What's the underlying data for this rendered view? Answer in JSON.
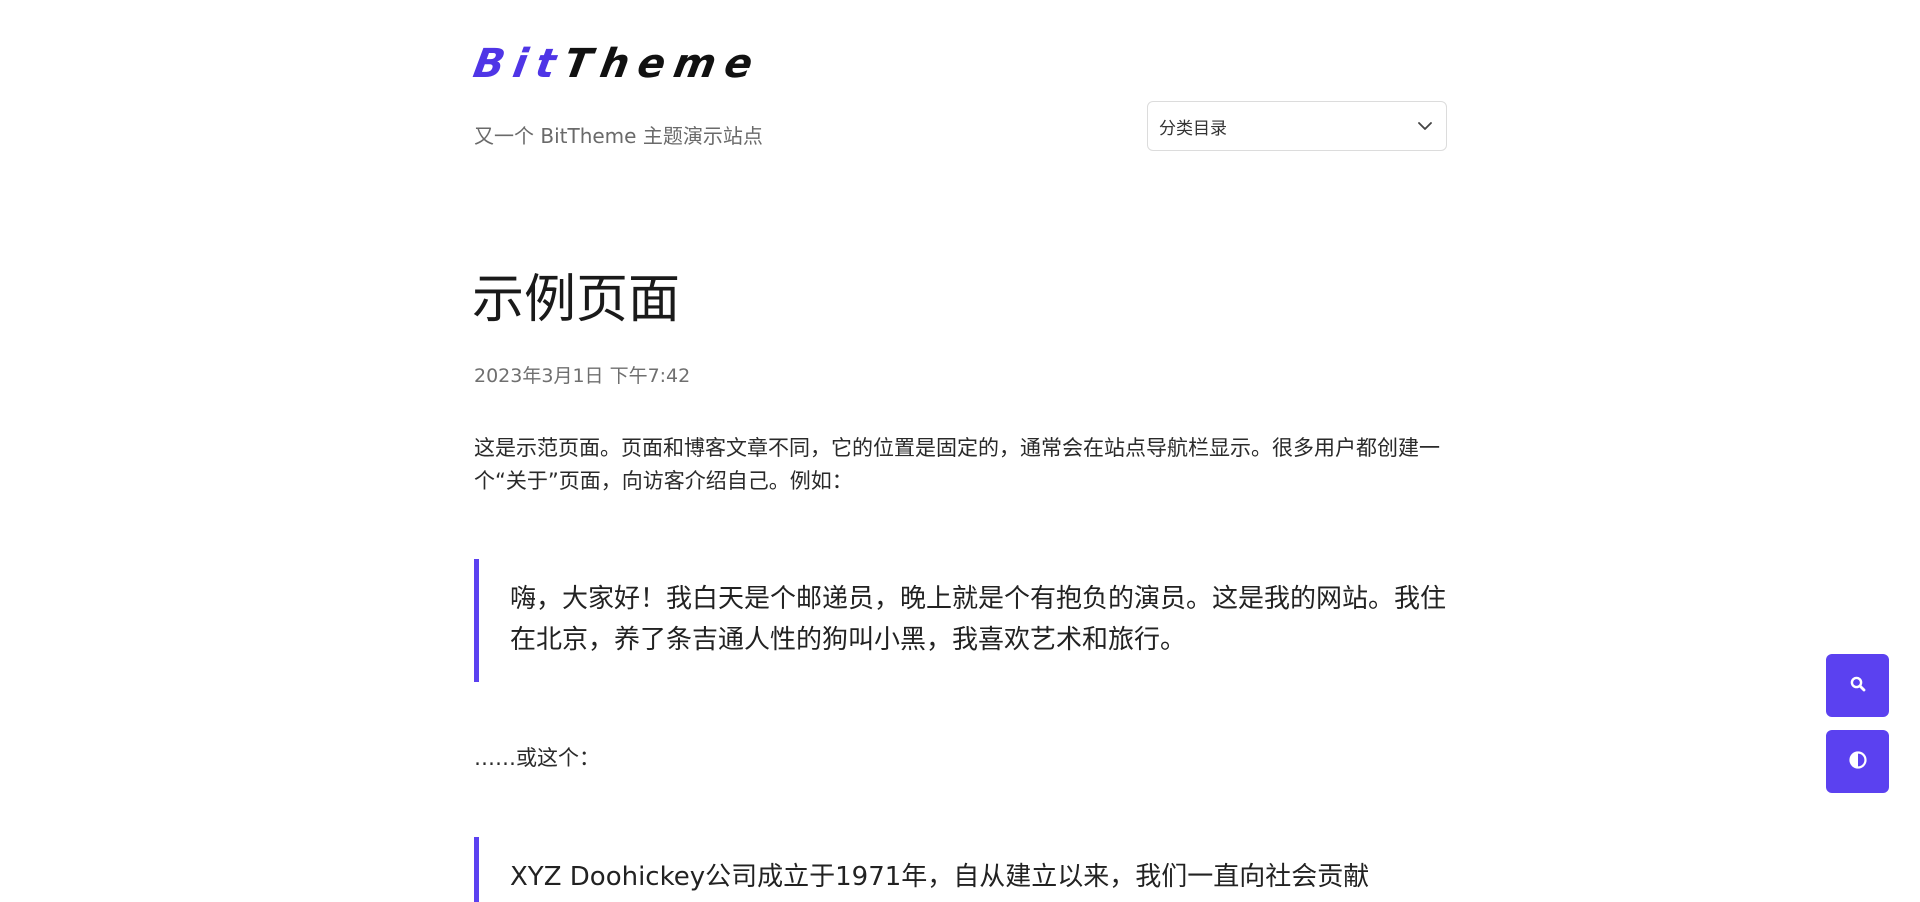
{
  "site": {
    "logo_accent": "Bit",
    "logo_rest": "Theme",
    "tagline": "又一个 BitTheme 主题演示站点",
    "accent_color": "#5b41f0"
  },
  "category_select": {
    "selected": "分类目录",
    "icon": "chevron-down-icon"
  },
  "article": {
    "title": "示例页面",
    "date": "2023年3月1日 下午7:42",
    "intro": "这是示范页面。页面和博客文章不同，它的位置是固定的，通常会在站点导航栏显示。很多用户都创建一个“关于”页面，向访客介绍自己。例如：",
    "quote_1": "嗨，大家好！我白天是个邮递员，晚上就是个有抱负的演员。这是我的网站。我住在北京，养了条吉通人性的狗叫小黑，我喜欢艺术和旅行。",
    "or_this": "……或这个：",
    "quote_2": "XYZ Doohickey公司成立于1971年，自从建立以来，我们一直向社会贡献"
  },
  "floating_buttons": {
    "search_icon": "search-icon",
    "theme_icon": "contrast-icon"
  }
}
